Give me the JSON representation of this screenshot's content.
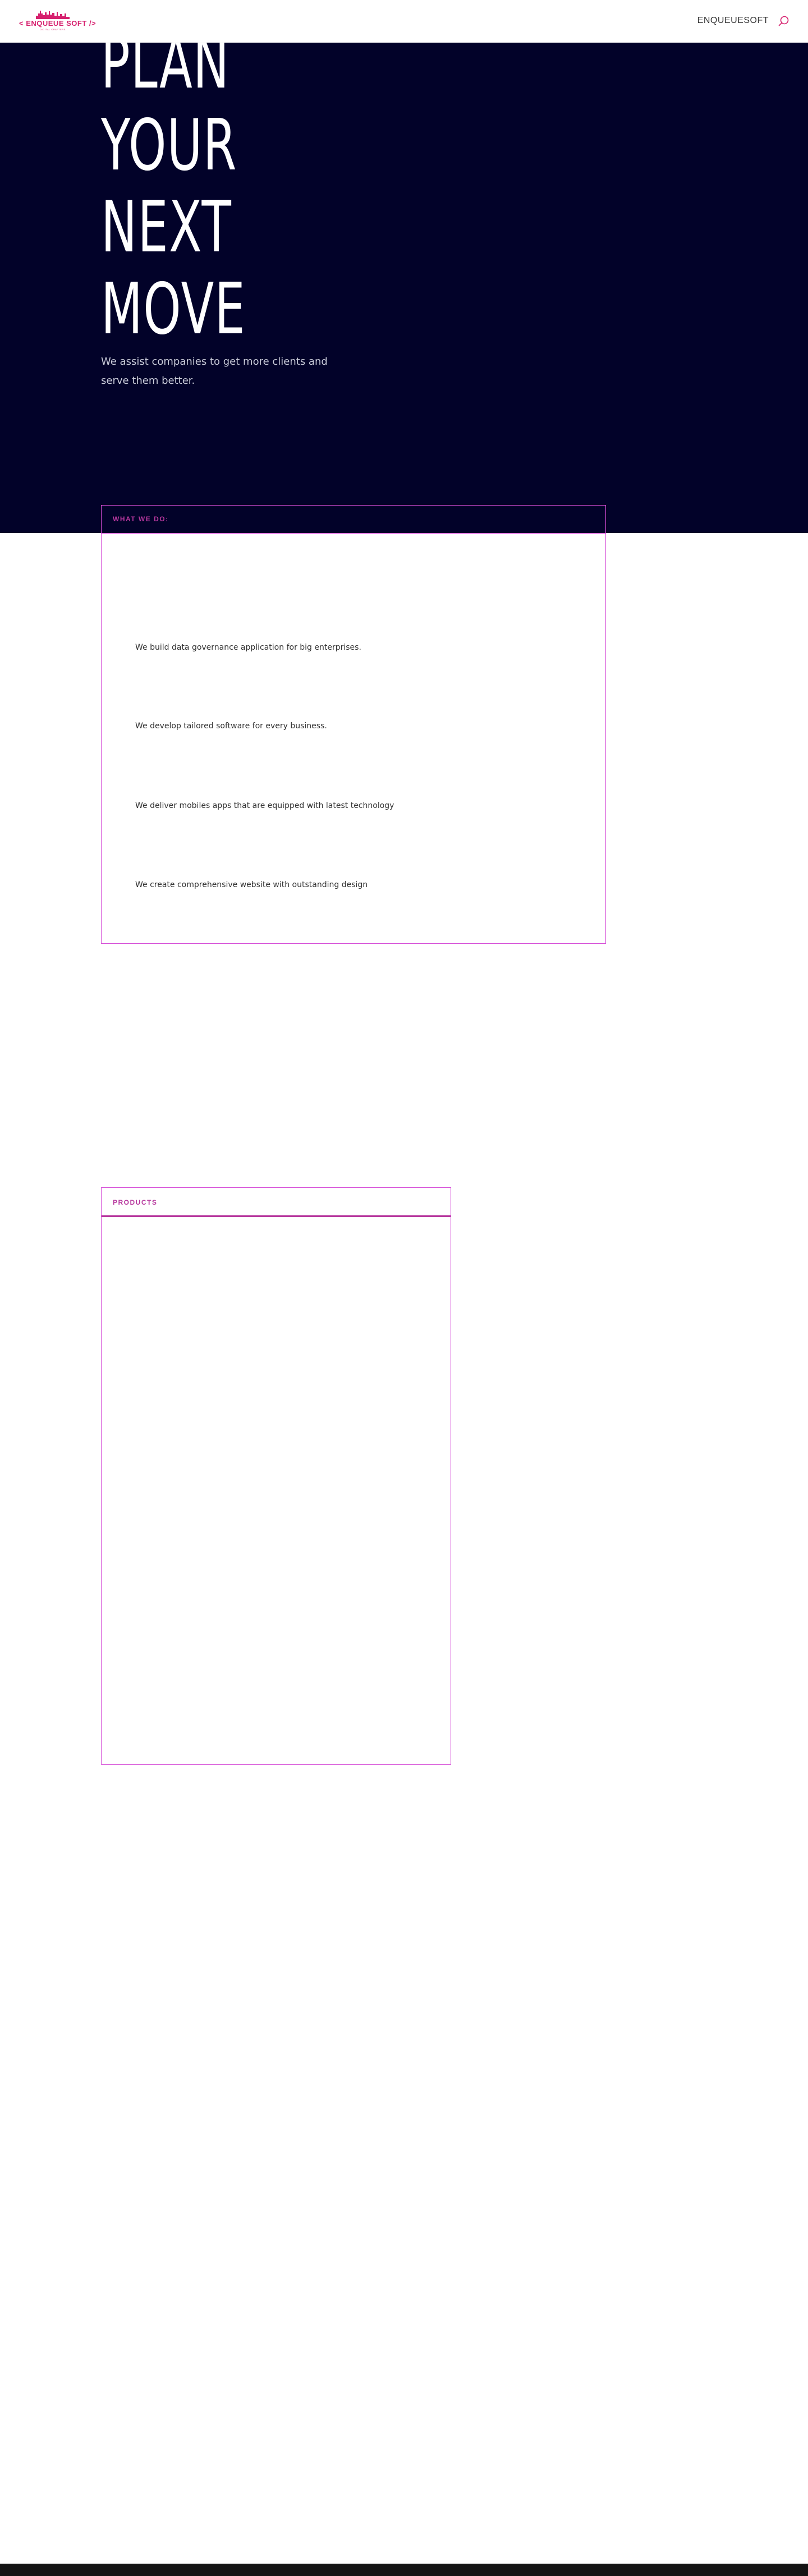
{
  "header": {
    "logo_text": "< ENQUEUE SOFT />",
    "logo_tagline": "DIGITAL CRAFTERS",
    "nav_link": "ENQUEUESOFT",
    "search_icon": "search-icon"
  },
  "hero": {
    "title_lines": [
      "PLAN",
      "YOUR",
      "NEXT",
      "MOVE"
    ],
    "subtitle": "We assist companies to get more clients and serve them better."
  },
  "what_we_do": {
    "label": "WHAT WE DO:",
    "items": [
      "We build data governance application for big enterprises.",
      "We develop tailored software for every business.",
      "We deliver mobiles apps that are equipped with latest technology",
      "We create comprehensive website with outstanding design"
    ]
  },
  "products": {
    "label": "PRODUCTS"
  },
  "colors": {
    "brand": "#d6206e",
    "accent": "#b7389e",
    "border": "#d64fd8",
    "hero_bg": "#020229",
    "footer_bg": "#141414"
  }
}
